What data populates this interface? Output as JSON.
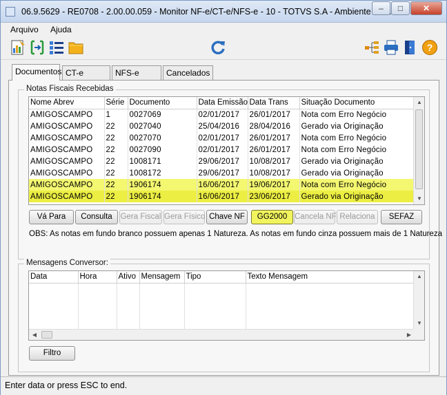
{
  "window": {
    "title": "06.9.5629 - RE0708 - 2.00.00.059 - Monitor NF-e/CT-e/NFS-e - 10 - TOTVS S.A - Ambiente Co...",
    "minimize": "–",
    "maximize": "□",
    "close": "✕"
  },
  "menu": {
    "items": [
      "Arquivo",
      "Ajuda"
    ]
  },
  "toolbar": {
    "left_icons": [
      "report-icon",
      "select-icon",
      "list-icon",
      "folder-icon"
    ],
    "center_icon": "refresh-icon",
    "right_icons": [
      "tree-icon",
      "printer-icon",
      "exit-door-icon",
      "help-icon"
    ]
  },
  "tabs": [
    "Documentos",
    "CT-e",
    "NFS-e",
    "Cancelados"
  ],
  "notas": {
    "group_title": "Notas Fiscais Recebidas",
    "columns": [
      "Nome Abrev",
      "Série",
      "Documento",
      "Data Emissão",
      "Data Trans",
      "Situação Documento"
    ],
    "rows": [
      [
        "AMIGOSCAMPO",
        "1",
        "0027069",
        "02/01/2017",
        "26/01/2017",
        "Nota com Erro Negócio"
      ],
      [
        "AMIGOSCAMPO",
        "22",
        "0027040",
        "25/04/2016",
        "28/04/2016",
        "Gerado via Originação"
      ],
      [
        "AMIGOSCAMPO",
        "22",
        "0027070",
        "02/01/2017",
        "26/01/2017",
        "Nota com Erro Negócio"
      ],
      [
        "AMIGOSCAMPO",
        "22",
        "0027090",
        "02/01/2017",
        "26/01/2017",
        "Nota com Erro Negócio"
      ],
      [
        "AMIGOSCAMPO",
        "22",
        "1008171",
        "29/06/2017",
        "10/08/2017",
        "Gerado via Originação"
      ],
      [
        "AMIGOSCAMPO",
        "22",
        "1008172",
        "29/06/2017",
        "10/08/2017",
        "Gerado via Originação"
      ],
      [
        "AMIGOSCAMPO",
        "22",
        "1906174",
        "16/06/2017",
        "19/06/2017",
        "Nota com Erro Negócio"
      ],
      [
        "AMIGOSCAMPO",
        "22",
        "1906174",
        "16/06/2017",
        "23/06/2017",
        "Gerado via Originação"
      ]
    ],
    "highlight_color": "#f4f770",
    "buttons": [
      {
        "label": "Vá Para",
        "enabled": true
      },
      {
        "label": "Consulta",
        "enabled": true
      },
      {
        "label": "Gera Fiscal",
        "enabled": false
      },
      {
        "label": "Gera Físico",
        "enabled": false
      },
      {
        "label": "Chave NF",
        "enabled": true
      },
      {
        "label": "GG2000",
        "enabled": true
      },
      {
        "label": "Cancela NF",
        "enabled": false
      },
      {
        "label": "Relaciona",
        "enabled": false
      },
      {
        "label": "SEFAZ",
        "enabled": true
      }
    ],
    "obs": "OBS: As notas em fundo branco possuem apenas 1 Natureza. As notas em fundo cinza possuem mais de 1 Natureza"
  },
  "mensagens": {
    "group_title": "Mensagens Conversor:",
    "columns": [
      "Data",
      "Hora",
      "Ativo",
      "Mensagem",
      "Tipo",
      "Texto Mensagem"
    ],
    "filter_button": "Filtro"
  },
  "status": {
    "text": "Enter data or press ESC to end."
  }
}
